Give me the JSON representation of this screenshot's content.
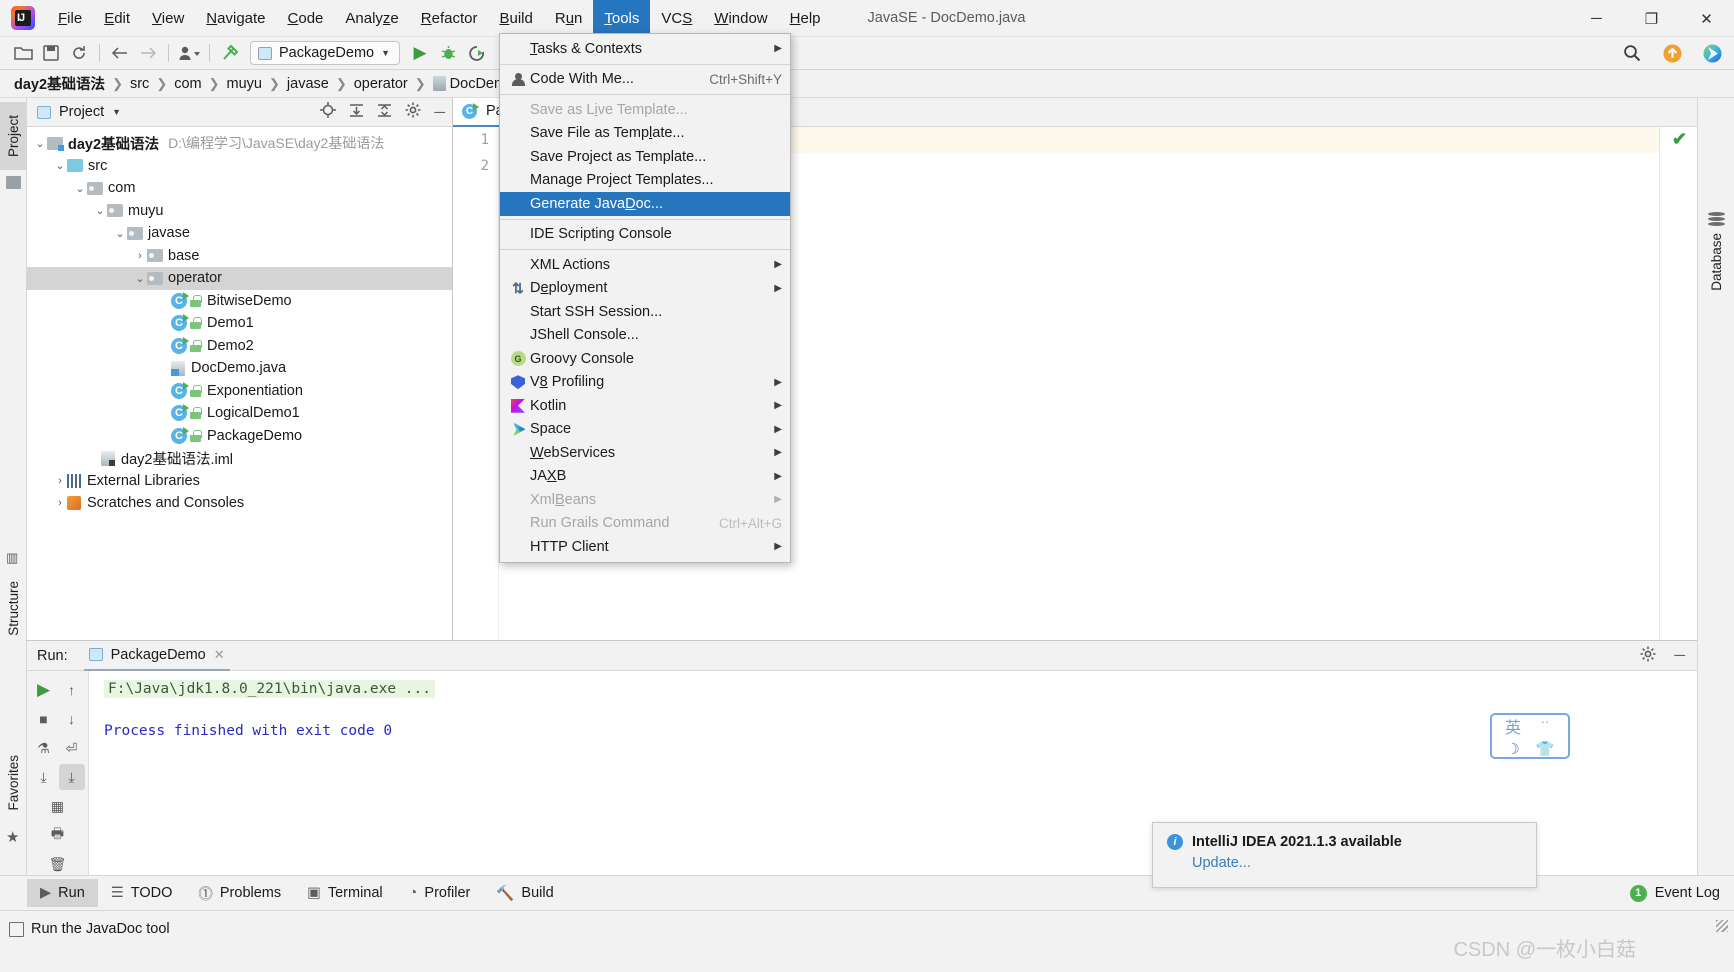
{
  "window": {
    "title": "JavaSE - DocDemo.java",
    "minimize": "─",
    "maximize": "❐",
    "close": "✕"
  },
  "menubar": {
    "items": [
      {
        "label": "File",
        "mnemonic": "F"
      },
      {
        "label": "Edit",
        "mnemonic": "E"
      },
      {
        "label": "View",
        "mnemonic": "V"
      },
      {
        "label": "Navigate",
        "mnemonic": "N"
      },
      {
        "label": "Code",
        "mnemonic": "C"
      },
      {
        "label": "Analyze",
        "mnemonic": "z"
      },
      {
        "label": "Refactor",
        "mnemonic": "R"
      },
      {
        "label": "Build",
        "mnemonic": "B"
      },
      {
        "label": "Run",
        "mnemonic": "u"
      },
      {
        "label": "Tools",
        "mnemonic": "T",
        "active": true
      },
      {
        "label": "VCS",
        "mnemonic": "S"
      },
      {
        "label": "Window",
        "mnemonic": "W"
      },
      {
        "label": "Help",
        "mnemonic": "H"
      }
    ]
  },
  "toolbar": {
    "open_icon": "📁",
    "save_icon": "💾",
    "sync_icon": "↻",
    "back_icon": "←",
    "forward_icon": "→",
    "profile_icon": "person",
    "build_icon": "hammer",
    "run_config": "PackageDemo",
    "run_icon": "▶",
    "debug_icon": "bug",
    "coverage_icon": "▶",
    "search_icon": "🔍",
    "update_icon": "↑",
    "space_icon": "space"
  },
  "breadcrumb": {
    "items": [
      "day2基础语法",
      "src",
      "com",
      "muyu",
      "javase",
      "operator",
      "DocDemo.java"
    ],
    "separator": "❯"
  },
  "project_panel": {
    "title": "Project",
    "caret": "▼",
    "actions": [
      "locate-icon",
      "expand-all-icon",
      "collapse-all-icon",
      "settings-icon",
      "hide-icon"
    ],
    "tree": [
      {
        "label": "day2基础语法",
        "path": "D:\\编程学习\\JavaSE\\day2基础语法",
        "indent": 0,
        "arrow": "⌄",
        "icon": "module",
        "bold": true
      },
      {
        "label": "src",
        "indent": 1,
        "arrow": "⌄",
        "icon": "folder-blue"
      },
      {
        "label": "com",
        "indent": 2,
        "arrow": "⌄",
        "icon": "folder-package"
      },
      {
        "label": "muyu",
        "indent": 3,
        "arrow": "⌄",
        "icon": "folder-package"
      },
      {
        "label": "javase",
        "indent": 4,
        "arrow": "⌄",
        "icon": "folder-package"
      },
      {
        "label": "base",
        "indent": 5,
        "arrow": "›",
        "icon": "folder-package"
      },
      {
        "label": "operator",
        "indent": 5,
        "arrow": "⌄",
        "icon": "folder-package",
        "selected": true
      },
      {
        "label": "BitwiseDemo",
        "indent": 6,
        "arrow": "",
        "icon": "java-class"
      },
      {
        "label": "Demo1",
        "indent": 6,
        "arrow": "",
        "icon": "java-class"
      },
      {
        "label": "Demo2",
        "indent": 6,
        "arrow": "",
        "icon": "java-class"
      },
      {
        "label": "DocDemo.java",
        "indent": 6,
        "arrow": "",
        "icon": "java-file"
      },
      {
        "label": "Exponentiation",
        "indent": 6,
        "arrow": "",
        "icon": "java-class"
      },
      {
        "label": "LogicalDemo1",
        "indent": 6,
        "arrow": "",
        "icon": "java-class"
      },
      {
        "label": "PackageDemo",
        "indent": 6,
        "arrow": "",
        "icon": "java-class"
      },
      {
        "label": "day2基础语法.iml",
        "indent": 2,
        "arrow": "",
        "icon": "iml-file"
      },
      {
        "label": "External Libraries",
        "indent": 1,
        "arrow": "›",
        "icon": "library"
      },
      {
        "label": "Scratches and Consoles",
        "indent": 1,
        "arrow": "›",
        "icon": "scratches"
      }
    ]
  },
  "left_rail": {
    "project_label": "Project",
    "structure_label": "Structure",
    "favorites_label": "Favorites"
  },
  "right_rail": {
    "database_label": "Database"
  },
  "editor": {
    "tab_label": "PackageDemo",
    "line_numbers": [
      "1",
      "2"
    ],
    "inspection_ok": "✔"
  },
  "tools_menu": {
    "items": [
      {
        "label": "Tasks & Contexts",
        "mnemonic": "T",
        "submenu": true,
        "icon": null
      },
      {
        "separator_after": true,
        "label": "Code With Me...",
        "mnemonic": null,
        "shortcut": "Ctrl+Shift+Y",
        "icon": "person-icon"
      },
      {
        "label": "Save as Live Template...",
        "mnemonic": "i",
        "disabled": true
      },
      {
        "label": "Save File as Template...",
        "mnemonic": "l"
      },
      {
        "label": "Save Project as Template...",
        "mnemonic": null
      },
      {
        "label": "Manage Project Templates...",
        "mnemonic": null
      },
      {
        "label": "Generate JavaDoc...",
        "mnemonic": "D",
        "highlighted": true
      },
      {
        "label": "IDE Scripting Console",
        "mnemonic": null,
        "separator_before": true
      },
      {
        "label": "XML Actions",
        "mnemonic": null,
        "submenu": true,
        "separator_before": true
      },
      {
        "label": "Deployment",
        "mnemonic": "e",
        "submenu": true,
        "icon": "deployment-icon"
      },
      {
        "label": "Start SSH Session...",
        "mnemonic": null
      },
      {
        "label": "JShell Console...",
        "mnemonic": null
      },
      {
        "label": "Groovy Console",
        "mnemonic": null,
        "icon": "groovy-icon"
      },
      {
        "label": "V8 Profiling",
        "mnemonic": "8",
        "submenu": true,
        "icon": "v8-icon"
      },
      {
        "label": "Kotlin",
        "mnemonic": null,
        "submenu": true,
        "icon": "kotlin-icon"
      },
      {
        "label": "Space",
        "mnemonic": null,
        "submenu": true,
        "icon": "space-icon"
      },
      {
        "label": "WebServices",
        "mnemonic": "W",
        "submenu": true
      },
      {
        "label": "JAXB",
        "mnemonic": "X",
        "submenu": true
      },
      {
        "label": "XmlBeans",
        "mnemonic": "B",
        "submenu": true,
        "disabled": true
      },
      {
        "label": "Run Grails Command",
        "shortcut": "Ctrl+Alt+G",
        "disabled": true
      },
      {
        "label": "HTTP Client",
        "submenu": true
      }
    ],
    "submenu_arrow": "▶"
  },
  "run_window": {
    "label": "Run:",
    "tab": "PackageDemo",
    "close_icon": "✕",
    "settings_icon": "⚙",
    "hide_icon": "─",
    "console": {
      "command": "F:\\Java\\jdk1.8.0_221\\bin\\java.exe ...",
      "result": "Process finished with exit code 0"
    },
    "side_icons": [
      "rerun-icon",
      "up-icon",
      "stop-icon",
      "down-icon",
      "filter-icon",
      "wrap-icon",
      "scroll-end-icon",
      "soft-wrap-icon",
      "print-icon",
      "trash-icon"
    ]
  },
  "notification": {
    "title": "IntelliJ IDEA 2021.1.3 available",
    "link": "Update...",
    "info_icon": "i"
  },
  "ime": {
    "lang": "英",
    "dots": "··",
    "moon": "☽",
    "shirt": "👕"
  },
  "bottom_bar": {
    "items": [
      {
        "label": "Run",
        "icon": "run-icon",
        "selected": true
      },
      {
        "label": "TODO",
        "icon": "todo-icon"
      },
      {
        "label": "Problems",
        "icon": "problems-icon"
      },
      {
        "label": "Terminal",
        "icon": "terminal-icon"
      },
      {
        "label": "Profiler",
        "icon": "profiler-icon"
      },
      {
        "label": "Build",
        "icon": "build-icon"
      }
    ],
    "event_log": "Event Log",
    "event_count": "1"
  },
  "status_bar": {
    "message": "Run the JavaDoc tool",
    "watermark": "CSDN @一枚小白菇"
  },
  "colors": {
    "accent": "#2675bf",
    "highlight": "#2675bf",
    "selection": "#d4d4d4",
    "console_cmd_bg": "#e8f5e0",
    "console_result": "#2b2bbf",
    "link": "#3b7cbd"
  }
}
